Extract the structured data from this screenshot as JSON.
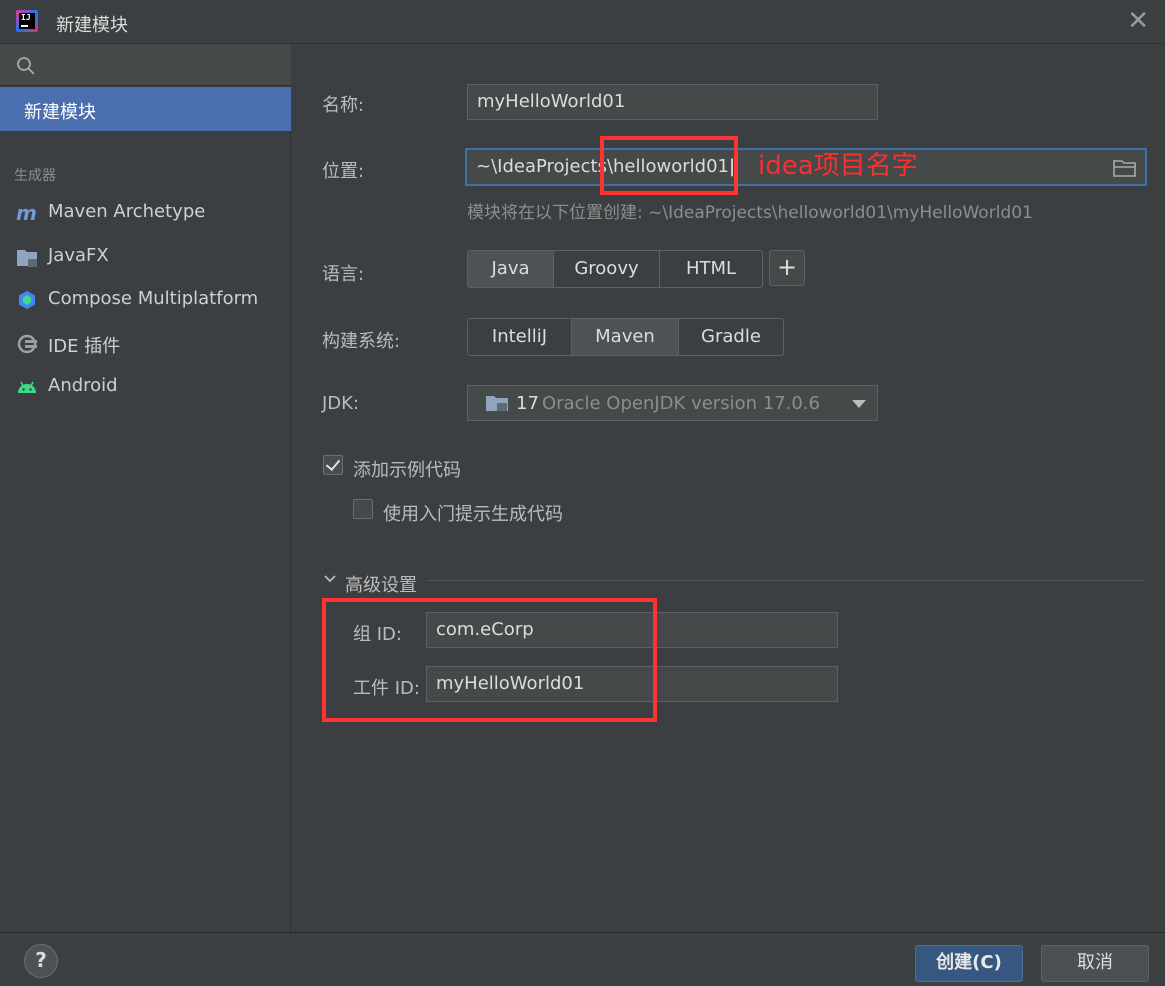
{
  "window": {
    "title": "新建模块"
  },
  "sidebar": {
    "selected_item": "新建模块",
    "section_title": "生成器",
    "items": [
      {
        "label": "Maven Archetype",
        "icon": "maven-icon"
      },
      {
        "label": "JavaFX",
        "icon": "javafx-icon"
      },
      {
        "label": "Compose Multiplatform",
        "icon": "compose-icon"
      },
      {
        "label": "IDE 插件",
        "icon": "plugin-icon"
      },
      {
        "label": "Android",
        "icon": "android-icon"
      }
    ]
  },
  "form": {
    "name_label": "名称:",
    "name_value": "myHelloWorld01",
    "location_label": "位置:",
    "location_value": "~\\IdeaProjects\\helloworld01",
    "location_hint": "模块将在以下位置创建: ~\\IdeaProjects\\helloworld01\\myHelloWorld01",
    "language_label": "语言:",
    "languages": [
      "Java",
      "Groovy",
      "HTML"
    ],
    "selected_language": "Java",
    "add_language": "+",
    "build_label": "构建系统:",
    "build_systems": [
      "IntelliJ",
      "Maven",
      "Gradle"
    ],
    "selected_build": "Maven",
    "jdk_label": "JDK:",
    "jdk_version": "17",
    "jdk_desc": "Oracle OpenJDK version 17.0.6",
    "sample_code_label": "添加示例代码",
    "sample_code_checked": true,
    "onboarding_label": "使用入门提示生成代码",
    "onboarding_checked": false,
    "advanced_title": "高级设置",
    "group_label": "组 ID:",
    "group_value": "com.eCorp",
    "artifact_label": "工件 ID:",
    "artifact_value": "myHelloWorld01"
  },
  "annotation": {
    "text": "idea项目名字",
    "color": "#ff3333"
  },
  "footer": {
    "help": "?",
    "create_button": "创建(C)",
    "cancel_button": "取消"
  },
  "colors": {
    "accent": "#4b6eaf",
    "primary_button": "#365880",
    "background": "#3c3f41"
  }
}
